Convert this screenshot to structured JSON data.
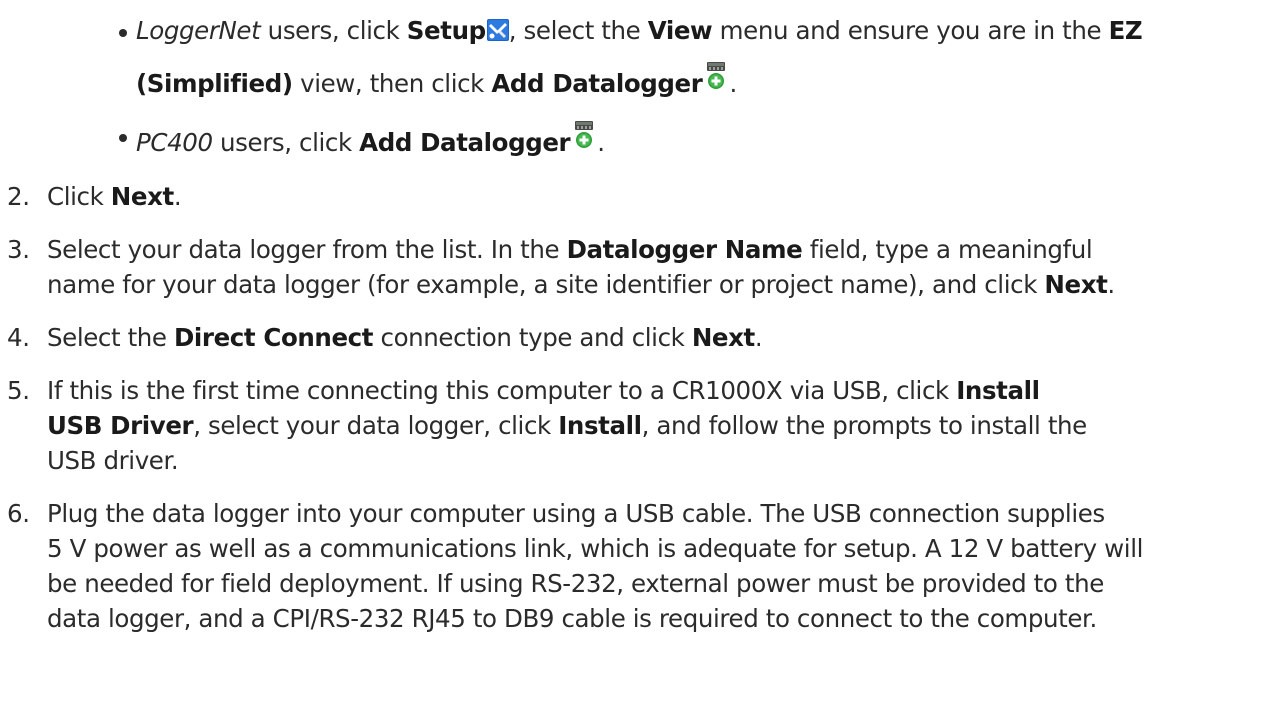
{
  "bullets": [
    {
      "line1": {
        "app": "LoggerNet",
        "t1": " users, click ",
        "setup": "Setup",
        "t2": ", select the ",
        "view": "View",
        "t3": " menu and ensure you are in the ",
        "ez": "EZ"
      },
      "line2": {
        "simplified": "(Simplified)",
        "t1": " view, then click ",
        "add": "Add Datalogger",
        "t2": "."
      }
    },
    {
      "line1": {
        "app": "PC400",
        "t1": " users, click ",
        "add": "Add Datalogger",
        "t2": "."
      }
    }
  ],
  "steps": [
    {
      "num": "2.",
      "lines": [
        {
          "t1": "Click ",
          "b1": "Next",
          "t2": "."
        }
      ]
    },
    {
      "num": "3.",
      "lines": [
        {
          "t1": "Select your data logger from the list. In the ",
          "b1": "Datalogger Name",
          "t2": " field, type a meaningful"
        },
        {
          "t1": "name for your data logger (for example, a site identifier or project name), and click ",
          "b1": "Next",
          "t2": "."
        }
      ]
    },
    {
      "num": "4.",
      "lines": [
        {
          "t1": "Select the ",
          "b1": "Direct Connect",
          "t2": " connection type and click ",
          "b2": "Next",
          "t3": "."
        }
      ]
    },
    {
      "num": "5.",
      "lines": [
        {
          "t1": "If this is the first time connecting this computer to a CR1000X via USB, click ",
          "b1": "Install"
        },
        {
          "b1": "USB Driver",
          "t1": ", select your data logger, click ",
          "b2": "Install",
          "t2": ", and follow the prompts to install the"
        },
        {
          "t1": "USB driver."
        }
      ]
    },
    {
      "num": "6.",
      "lines": [
        {
          "t1": "Plug the data logger into your computer using a USB  cable. The USB connection supplies"
        },
        {
          "t1": "5 V power as well as a communications link, which is adequate for setup. A 12 V battery will"
        },
        {
          "t1": "be needed for field deployment. If using RS-232, external power must be provided to the"
        },
        {
          "t1": "data logger, and a CPI/RS-232 RJ45 to DB9 cable is required to connect to the computer."
        }
      ]
    }
  ]
}
